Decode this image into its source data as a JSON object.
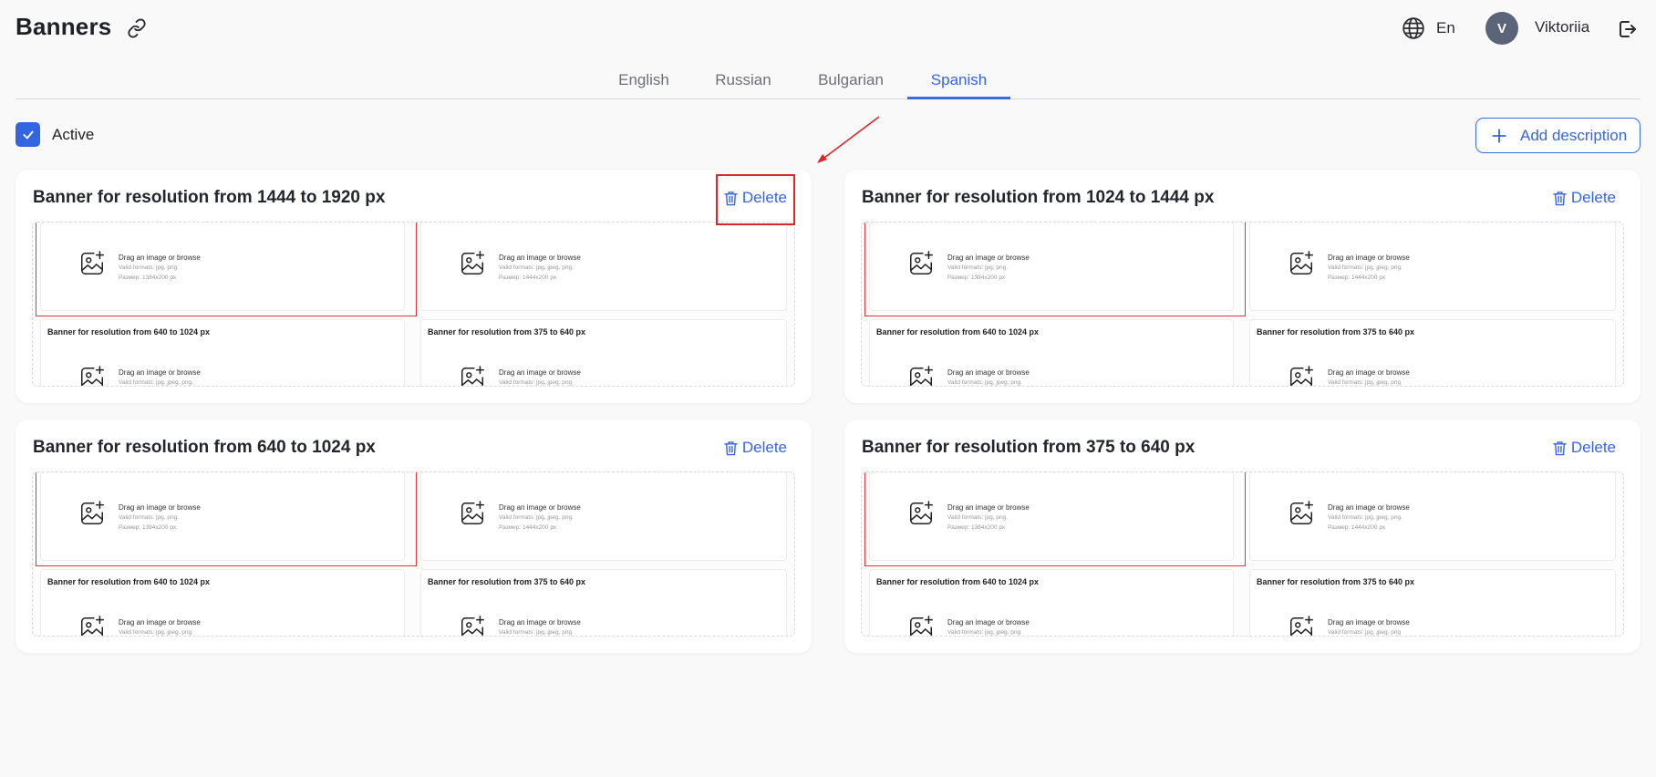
{
  "header": {
    "title": "Banners",
    "language_label": "En",
    "avatar_initial": "V",
    "user_name": "Viktoriia"
  },
  "tabs": [
    {
      "label": "English",
      "active": false
    },
    {
      "label": "Russian",
      "active": false
    },
    {
      "label": "Bulgarian",
      "active": false
    },
    {
      "label": "Spanish",
      "active": true
    }
  ],
  "active_label": "Active",
  "active_checked": true,
  "add_description_label": "Add description",
  "delete_label": "Delete",
  "cards": [
    {
      "title": "Banner for resolution from 1444 to 1920 px"
    },
    {
      "title": "Banner for resolution from 1024 to 1444 px"
    },
    {
      "title": "Banner for resolution from 640 to 1024 px"
    },
    {
      "title": "Banner for resolution from 375 to 640 px"
    }
  ],
  "preview": {
    "drop_text": "Drag an image or browse",
    "formats_text_a": "Valid formats: jpg, png.",
    "formats_text_b": "Valid formats: jpg, jpeg, png.",
    "formats_text_c": "Valid formats: jpg, jpeg, png",
    "size_text_a": "Размер: 1384x200 px",
    "size_text_b": "Размер: 1444x200 px",
    "mini_title_left": "Banner for resolution from 640 to 1024 px",
    "mini_title_right": "Banner for resolution from 375 to 640 px"
  },
  "colors": {
    "accent": "#3765e0",
    "annotation": "#e0252a",
    "avatar": "#5b6478"
  }
}
